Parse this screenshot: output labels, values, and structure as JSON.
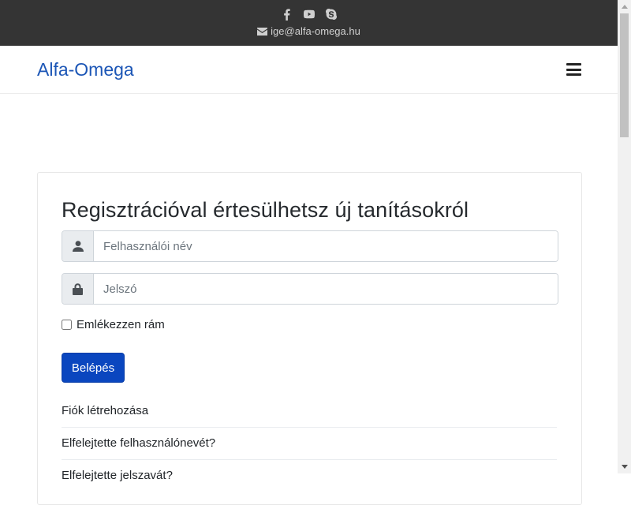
{
  "topbar": {
    "icons": [
      "facebook-icon",
      "youtube-icon",
      "skype-icon"
    ],
    "email": "ige@alfa-omega.hu"
  },
  "navbar": {
    "brand": "Alfa-Omega"
  },
  "login": {
    "heading": "Regisztrációval értesülhetsz új tanításokról",
    "username_placeholder": "Felhasználói név",
    "password_placeholder": "Jelszó",
    "remember_label": "Emlékezzen rám",
    "login_button": "Belépés",
    "links": [
      "Fiók létrehozása",
      "Elfelejtette felhasználónevét?",
      "Elfelejtette jelszavát?"
    ]
  },
  "colors": {
    "topbar_bg": "#343434",
    "brand": "#1c56b6",
    "primary_button": "#0a46bf"
  }
}
